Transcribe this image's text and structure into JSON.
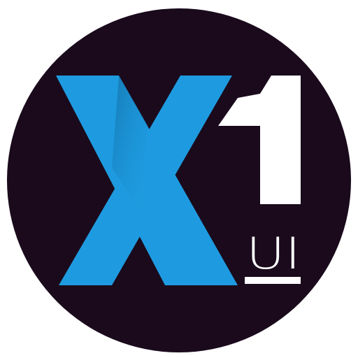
{
  "logo": {
    "brand_text": "X1",
    "sub_label": "UI",
    "colors": {
      "background_circle": "#1A0A1C",
      "accent_blue": "#1E9BE0",
      "accent_blue_shadow": "#1678B4",
      "foreground_white": "#FFFFFF",
      "page_background": "#FFFFFF"
    }
  }
}
